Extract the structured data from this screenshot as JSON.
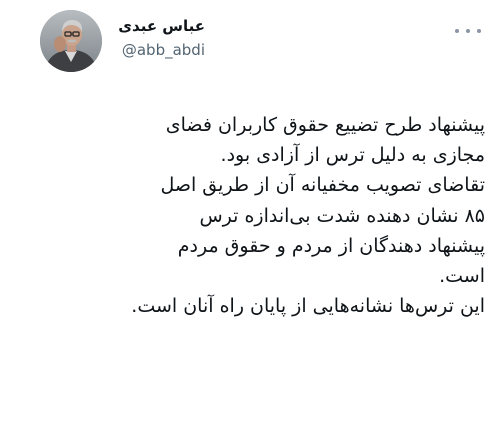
{
  "author": {
    "display_name": "عباس عبدی",
    "handle": "@abb_abdi"
  },
  "tweet": {
    "lines": [
      "پیشنهاد طرح تضییع حقوق کاربران فضای",
      "مجازی به دلیل ترس از آزادی بود.",
      "تقاضای تصویب مخفیانه آن از طریق اصل",
      "۸۵ نشان دهنده شدت بی‌اندازه ترس",
      "پیشنهاد دهندگان از مردم و حقوق مردم",
      "است.",
      "این ترس‌ها نشانه‌هایی از پایان راه آنان است."
    ]
  },
  "icons": {
    "more": "more-horizontal-icon",
    "avatar": "profile-photo"
  },
  "colors": {
    "text": "#0f1419",
    "secondary_text": "#536471",
    "icon": "#8a96a3",
    "background": "#ffffff"
  }
}
